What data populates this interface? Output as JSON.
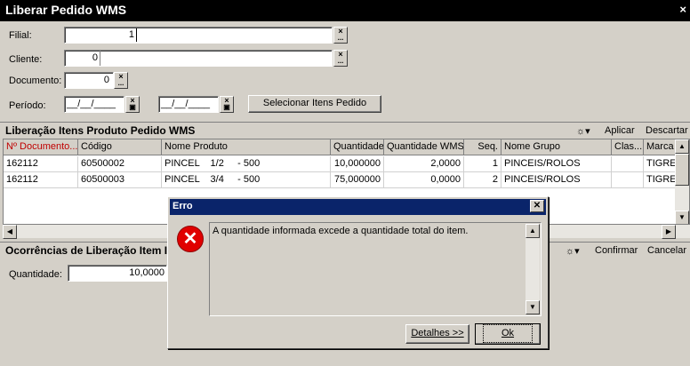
{
  "window": {
    "title": "Liberar Pedido WMS",
    "close": "×"
  },
  "form": {
    "filial_label": "Filial:",
    "filial_value": "1",
    "cliente_label": "Cliente:",
    "cliente_value": "0",
    "documento_label": "Documento:",
    "documento_value": "0",
    "periodo_label": "Período:",
    "periodo_from": "__/__/____",
    "periodo_to": "__/__/____",
    "select_items_button": "Selecionar Itens Pedido",
    "lookup_icon_top": "×",
    "lookup_icon_bottom": "..."
  },
  "section1": {
    "title": "Liberação Itens Produto Pedido WMS",
    "apply": "Aplicar",
    "discard": "Descartar"
  },
  "grid": {
    "columns": [
      "Nº Documento...",
      "Código",
      "Nome Produto",
      "Quantidade",
      "Quantidade WMS",
      "Seq.",
      "Nome Grupo",
      "Clas...",
      "Marca"
    ],
    "rows": [
      [
        "162112",
        "60500002",
        "PINCEL    1/2     - 500",
        "10,000000",
        "2,0000",
        "1",
        "PINCEIS/ROLOS",
        "",
        "TIGRE"
      ],
      [
        "162112",
        "60500003",
        "PINCEL    3/4     - 500",
        "75,000000",
        "0,0000",
        "2",
        "PINCEIS/ROLOS",
        "",
        "TIGRE"
      ]
    ]
  },
  "section2": {
    "title": "Ocorrências de Liberação Item I",
    "confirm": "Confirmar",
    "cancel": "Cancelar",
    "quantity_label": "Quantidade:",
    "quantity_value": "10,0000"
  },
  "dialog": {
    "title": "Erro",
    "message": "A quantidade informada excede a quantidade total do item.",
    "details_button": "Detalhes >>",
    "ok_button": "Ok",
    "icon": "error-icon"
  }
}
